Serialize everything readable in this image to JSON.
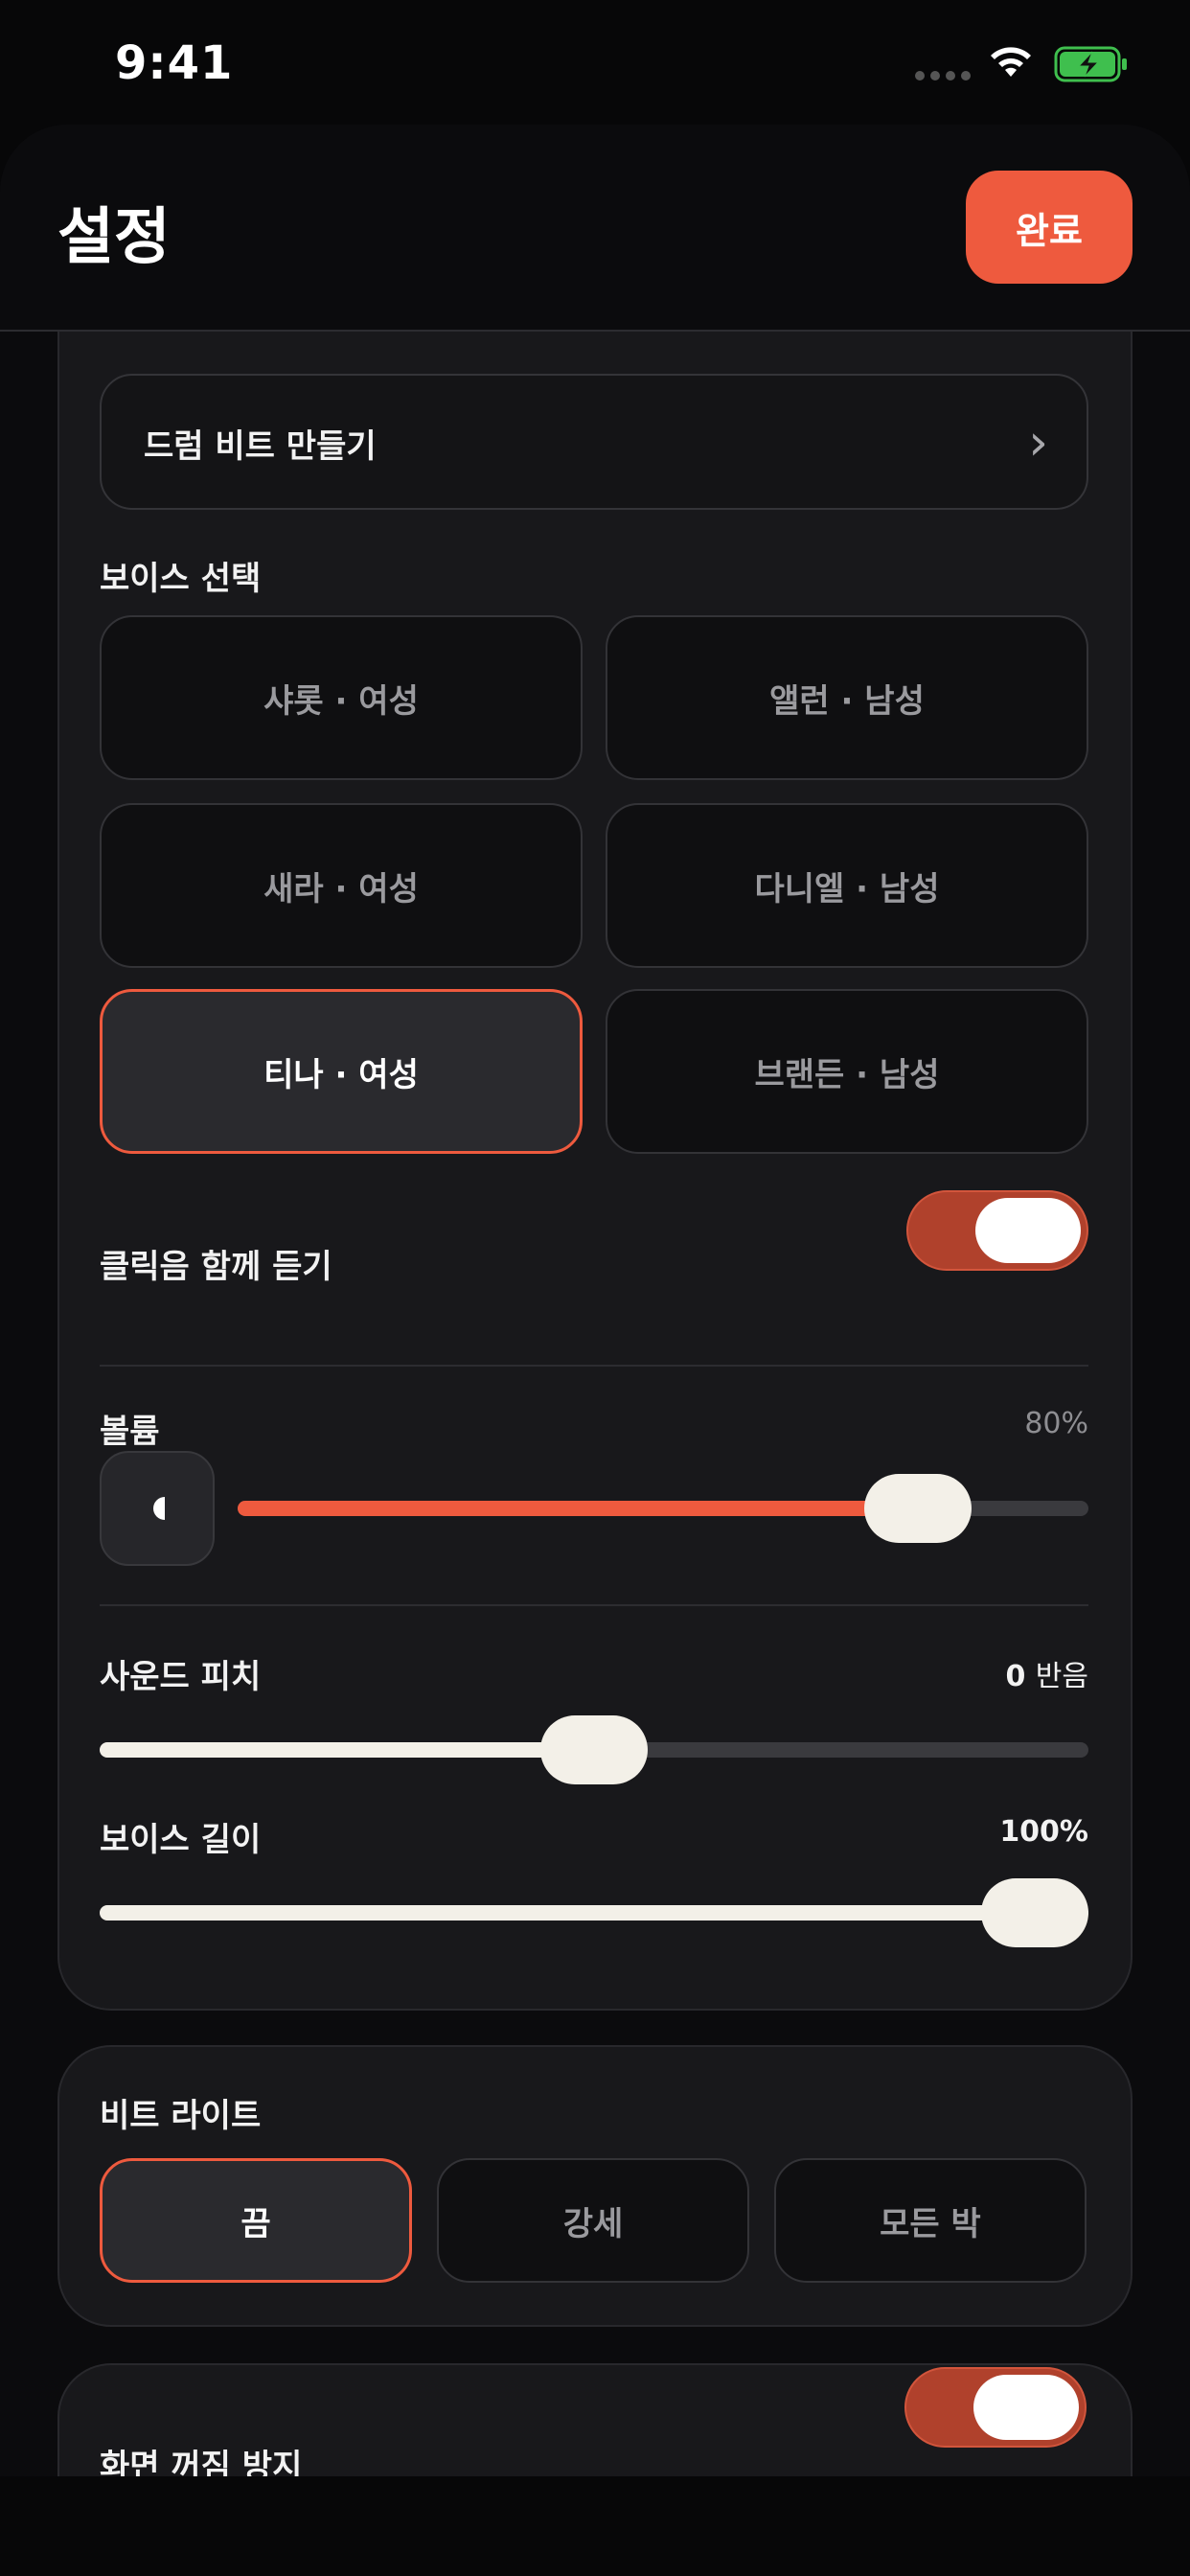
{
  "status_bar": {
    "time": "9:41"
  },
  "header": {
    "title": "설정",
    "done_label": "완료"
  },
  "drum_link": {
    "label": "드럼 비트 만들기",
    "chevron": "›"
  },
  "voice_section": {
    "label": "보이스 선택",
    "options": [
      {
        "label": "샤롯 · 여성",
        "selected": false
      },
      {
        "label": "앨런 · 남성",
        "selected": false
      },
      {
        "label": "새라 · 여성",
        "selected": false
      },
      {
        "label": "다니엘 · 남성",
        "selected": false
      },
      {
        "label": "티나 · 여성",
        "selected": true
      },
      {
        "label": "브랜든 · 남성",
        "selected": false
      }
    ]
  },
  "click_with": {
    "label": "클릭음 함께 듣기",
    "on": true
  },
  "volume": {
    "label": "볼륨",
    "value_text": "80%",
    "value": 0.8
  },
  "pitch": {
    "label": "사운드 피치",
    "value_number": "0",
    "value_unit": "반음",
    "value": 0.5
  },
  "voice_length": {
    "label": "보이스 길이",
    "value_text": "100%",
    "value": 1.0
  },
  "beat_light": {
    "label": "비트 라이트",
    "options": [
      {
        "label": "끔",
        "selected": true
      },
      {
        "label": "강세",
        "selected": false
      },
      {
        "label": "모든 박",
        "selected": false
      }
    ]
  },
  "screen_awake": {
    "label": "화면 꺼짐 방지",
    "on": true
  },
  "colors": {
    "accent": "#ee5a3e",
    "toggle_on": "#b0412c",
    "thumb": "#f3f0e8",
    "card": "#18181b"
  }
}
